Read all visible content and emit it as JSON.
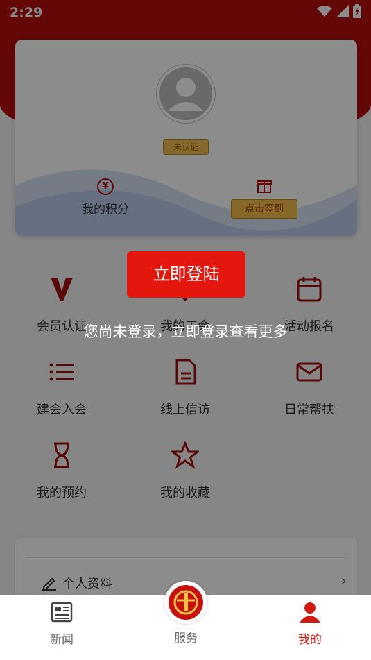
{
  "status": {
    "time": "2:29"
  },
  "profile": {
    "badge": "未认证",
    "points_label": "我的积分",
    "points_icon": "¥",
    "signin_label": "点击签到"
  },
  "grid": [
    {
      "label": "会员认证",
      "icon": "v-icon"
    },
    {
      "label": "我的工会",
      "icon": "heart-icon"
    },
    {
      "label": "活动报名",
      "icon": "calendar-icon"
    },
    {
      "label": "建会入会",
      "icon": "list-icon"
    },
    {
      "label": "线上信访",
      "icon": "document-icon"
    },
    {
      "label": "日常帮扶",
      "icon": "mail-icon"
    },
    {
      "label": "我的预约",
      "icon": "hourglass-icon"
    },
    {
      "label": "我的收藏",
      "icon": "star-icon"
    }
  ],
  "list": {
    "profile_item": "个人资料",
    "arrow": "›"
  },
  "login": {
    "button": "立即登陆",
    "message": "您尚未登录，立即登录查看更多"
  },
  "tabs": {
    "news": "新闻",
    "service": "服务",
    "mine": "我的"
  },
  "colors": {
    "brand": "#b50d0d",
    "accent": "#e3170d",
    "icon_red": "#a01010"
  }
}
